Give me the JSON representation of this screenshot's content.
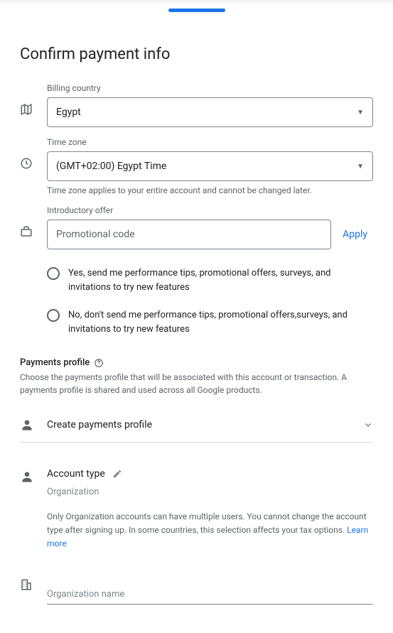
{
  "page_title": "Confirm payment info",
  "billing": {
    "label": "Billing country",
    "value": "Egypt"
  },
  "timezone": {
    "label": "Time zone",
    "value": "(GMT+02:00) Egypt Time",
    "helper": "Time zone applies to your entire account and cannot be changed later."
  },
  "offer": {
    "label": "Introductory offer",
    "placeholder": "Promotional code",
    "apply_label": "Apply"
  },
  "radios": {
    "yes": "Yes, send me performance tips, promotional offers, surveys, and invitations to try new features",
    "no": "No, don't send me performance tips, promotional offers,surveys, and invitations to try new features"
  },
  "profile": {
    "title": "Payments profile",
    "desc": "Choose the payments profile that will be associated with this account or transaction. A payments profile is shared and used across all Google products.",
    "create_label": "Create payments profile"
  },
  "account": {
    "type_label": "Account type",
    "type_value": "Organization",
    "desc": "Only Organization accounts can have multiple users. You cannot change the account type after signing up. In some countries, this selection affects your tax options. ",
    "learn_more": "Learn more"
  },
  "org": {
    "placeholder": "Organization name"
  }
}
